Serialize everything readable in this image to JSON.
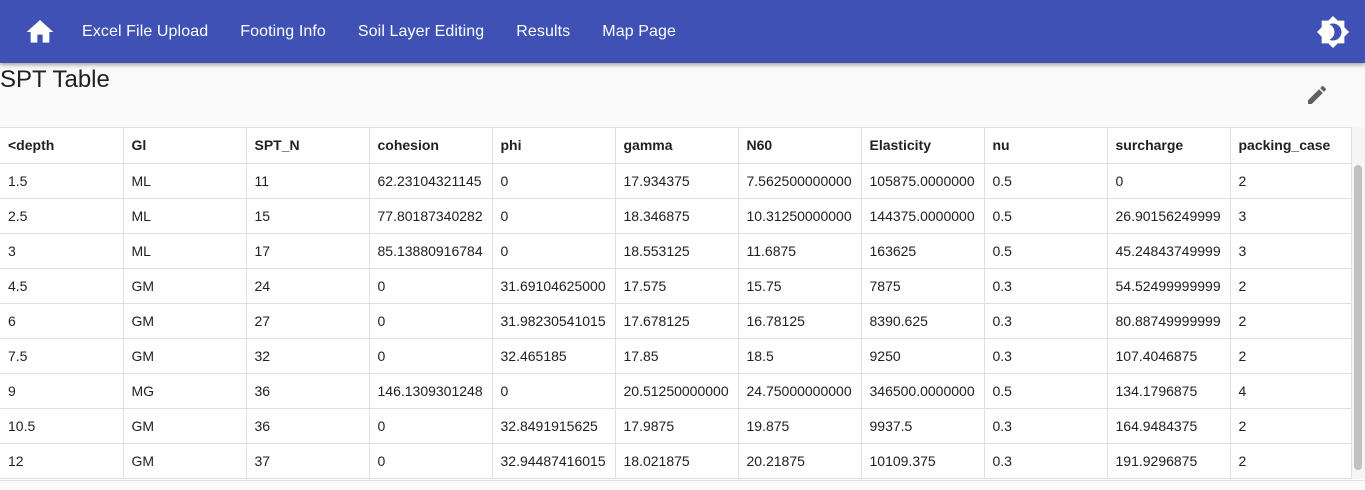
{
  "nav": {
    "items": [
      "Excel File Upload",
      "Footing Info",
      "Soil Layer Editing",
      "Results",
      "Map Page"
    ]
  },
  "icons": {
    "home": "home-icon",
    "theme": "brightness-icon",
    "edit": "pencil-icon"
  },
  "colors": {
    "appbar": "#3f51b5"
  },
  "page": {
    "title": "SPT Table"
  },
  "table": {
    "headers": [
      "<depth",
      "Gl",
      "SPT_N",
      "cohesion",
      "phi",
      "gamma",
      "N60",
      "Elasticity",
      "nu",
      "surcharge",
      "packing_case"
    ],
    "rows": [
      [
        "1.5",
        "ML",
        "11",
        "62.23104321145",
        "0",
        "17.934375",
        "7.562500000000",
        "105875.0000000",
        "0.5",
        "0",
        "2"
      ],
      [
        "2.5",
        "ML",
        "15",
        "77.80187340282",
        "0",
        "18.346875",
        "10.31250000000",
        "144375.0000000",
        "0.5",
        "26.90156249999",
        "3"
      ],
      [
        "3",
        "ML",
        "17",
        "85.13880916784",
        "0",
        "18.553125",
        "11.6875",
        "163625",
        "0.5",
        "45.24843749999",
        "3"
      ],
      [
        "4.5",
        "GM",
        "24",
        "0",
        "31.69104625000",
        "17.575",
        "15.75",
        "7875",
        "0.3",
        "54.52499999999",
        "2"
      ],
      [
        "6",
        "GM",
        "27",
        "0",
        "31.98230541015",
        "17.678125",
        "16.78125",
        "8390.625",
        "0.3",
        "80.88749999999",
        "2"
      ],
      [
        "7.5",
        "GM",
        "32",
        "0",
        "32.465185",
        "17.85",
        "18.5",
        "9250",
        "0.3",
        "107.4046875",
        "2"
      ],
      [
        "9",
        "MG",
        "36",
        "146.1309301248",
        "0",
        "20.51250000000",
        "24.75000000000",
        "346500.0000000",
        "0.5",
        "134.1796875",
        "4"
      ],
      [
        "10.5",
        "GM",
        "36",
        "0",
        "32.8491915625",
        "17.9875",
        "19.875",
        "9937.5",
        "0.3",
        "164.9484375",
        "2"
      ],
      [
        "12",
        "GM",
        "37",
        "0",
        "32.94487416015",
        "18.021875",
        "20.21875",
        "10109.375",
        "0.3",
        "191.9296875",
        "2"
      ]
    ]
  }
}
